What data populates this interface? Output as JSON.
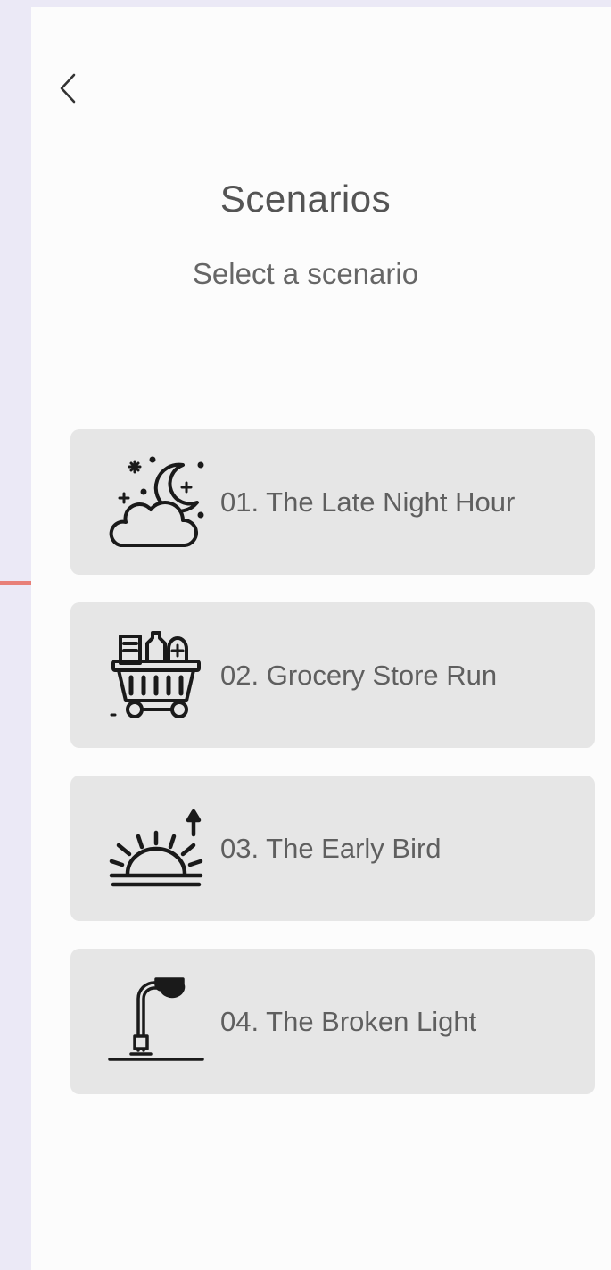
{
  "header": {
    "back_icon": "chevron-left-icon",
    "title": "Scenarios",
    "subtitle": "Select a scenario"
  },
  "colors": {
    "backdrop": "#ebe9f6",
    "screen": "#fcfcfc",
    "card": "#e6e6e6",
    "text": "#5f5f5f",
    "accent": "#e87f78"
  },
  "scenarios": [
    {
      "label": "01. The Late Night Hour",
      "icon": "moon-cloud-icon"
    },
    {
      "label": "02. Grocery Store Run",
      "icon": "grocery-basket-icon"
    },
    {
      "label": "03. The Early Bird",
      "icon": "sunrise-icon"
    },
    {
      "label": "04. The Broken Light",
      "icon": "street-lamp-icon"
    }
  ]
}
